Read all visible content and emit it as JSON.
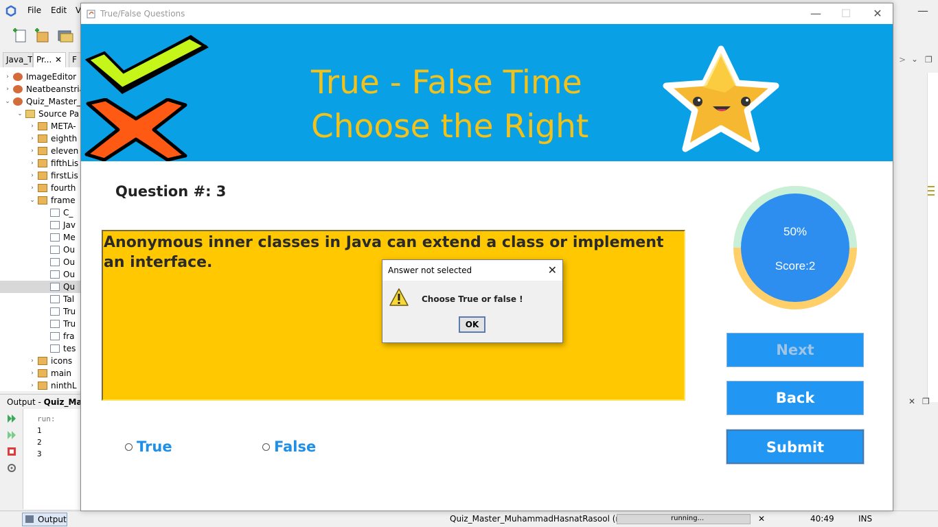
{
  "ide": {
    "menu": [
      "File",
      "Edit",
      "V"
    ],
    "tabs": [
      "Java_T...",
      "Pr...",
      "F"
    ],
    "tree": [
      {
        "label": "ImageEditor",
        "type": "proj",
        "level": 0,
        "exp": ">"
      },
      {
        "label": "Neatbeanstria",
        "type": "proj",
        "level": 0,
        "exp": ">"
      },
      {
        "label": "Quiz_Master_",
        "type": "proj",
        "level": 0,
        "exp": "v"
      },
      {
        "label": "Source Pa",
        "type": "folder",
        "level": 1,
        "exp": "v"
      },
      {
        "label": "META-",
        "type": "pkg",
        "level": 2,
        "exp": ">"
      },
      {
        "label": "eighth",
        "type": "pkg",
        "level": 2,
        "exp": ">"
      },
      {
        "label": "eleven",
        "type": "pkg",
        "level": 2,
        "exp": ">"
      },
      {
        "label": "fifthLis",
        "type": "pkg",
        "level": 2,
        "exp": ">"
      },
      {
        "label": "firstLis",
        "type": "pkg",
        "level": 2,
        "exp": ">"
      },
      {
        "label": "fourth",
        "type": "pkg",
        "level": 2,
        "exp": ">"
      },
      {
        "label": "frame",
        "type": "pkg",
        "level": 2,
        "exp": "v"
      },
      {
        "label": "C_",
        "type": "file",
        "level": 3,
        "exp": ""
      },
      {
        "label": "Jav",
        "type": "file",
        "level": 3,
        "exp": ""
      },
      {
        "label": "Me",
        "type": "file",
        "level": 3,
        "exp": ""
      },
      {
        "label": "Ou",
        "type": "file",
        "level": 3,
        "exp": ""
      },
      {
        "label": "Ou",
        "type": "file",
        "level": 3,
        "exp": ""
      },
      {
        "label": "Ou",
        "type": "file",
        "level": 3,
        "exp": ""
      },
      {
        "label": "Qu",
        "type": "file",
        "level": 3,
        "exp": ""
      },
      {
        "label": "Tal",
        "type": "file",
        "level": 3,
        "exp": ""
      },
      {
        "label": "Tru",
        "type": "file",
        "level": 3,
        "exp": ""
      },
      {
        "label": "Tru",
        "type": "file",
        "level": 3,
        "exp": ""
      },
      {
        "label": "fra",
        "type": "file",
        "level": 3,
        "exp": ""
      },
      {
        "label": "tes",
        "type": "file",
        "level": 3,
        "exp": ""
      },
      {
        "label": "icons",
        "type": "pkg",
        "level": 2,
        "exp": ">"
      },
      {
        "label": "main",
        "type": "pkg",
        "level": 2,
        "exp": ">"
      },
      {
        "label": "ninthL",
        "type": "pkg",
        "level": 2,
        "exp": ">"
      }
    ],
    "output": {
      "title_prefix": "Output - ",
      "title_bold": "Quiz_Mast",
      "lines": [
        "run:",
        "1",
        "2",
        "3"
      ]
    },
    "status": {
      "output_tab": "Output",
      "project": "Quiz_Master_MuhammadHasnatRasool (run)",
      "progress": "running...",
      "position": "40:49",
      "mode": "INS"
    }
  },
  "quiz": {
    "window_title": "True/False Questions",
    "banner": {
      "line1": "True - False Time",
      "line2": "Choose the Right"
    },
    "question_number": "Question #: 3",
    "question_text": "Anonymous inner classes in Java can extend a class or implement an interface.",
    "options": [
      "True",
      "False"
    ],
    "progress": {
      "percent_label": "50%",
      "score_label": "Score:2",
      "fraction": 0.5
    },
    "buttons": {
      "next": "Next",
      "back": "Back",
      "submit": "Submit"
    },
    "colors": {
      "banner": "#0aa0e6",
      "question_box": "#ffc800",
      "accent": "#2196f3"
    }
  },
  "dialog": {
    "title": "Answer not selected",
    "message": "Choose True or false !",
    "ok": "OK"
  }
}
